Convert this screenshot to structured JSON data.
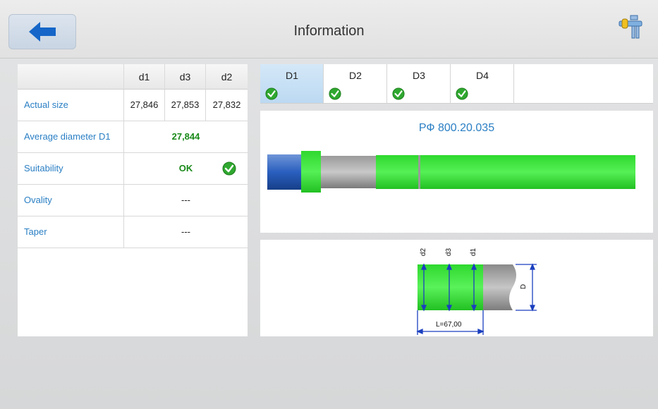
{
  "header": {
    "title": "Information"
  },
  "table": {
    "columns": [
      "d1",
      "d3",
      "d2"
    ],
    "rows": [
      {
        "label": "Actual size",
        "values": [
          "27,846",
          "27,853",
          "27,832"
        ]
      },
      {
        "label": "Average diameter D1",
        "value": "27,844"
      },
      {
        "label": "Suitability",
        "value": "OK"
      },
      {
        "label": "Ovality",
        "value": "---"
      },
      {
        "label": "Taper",
        "value": "---"
      }
    ]
  },
  "tabs": [
    {
      "label": "D1",
      "status": "ok",
      "selected": true
    },
    {
      "label": "D2",
      "status": "ok",
      "selected": false
    },
    {
      "label": "D3",
      "status": "ok",
      "selected": false
    },
    {
      "label": "D4",
      "status": "ok",
      "selected": false
    }
  ],
  "part": {
    "name": "РФ 800.20.035"
  },
  "dimension": {
    "labels": [
      "d2",
      "d3",
      "d1"
    ],
    "length_label": "L=67,00",
    "diameter_label": "D"
  },
  "colors": {
    "accent_blue": "#2a7fc4",
    "ok_green": "#1a8a1a",
    "highlight_green": "#3ee83e"
  },
  "icons": {
    "back": "arrow-left-icon",
    "tool": "caliper-icon",
    "check": "check-circle-icon"
  }
}
